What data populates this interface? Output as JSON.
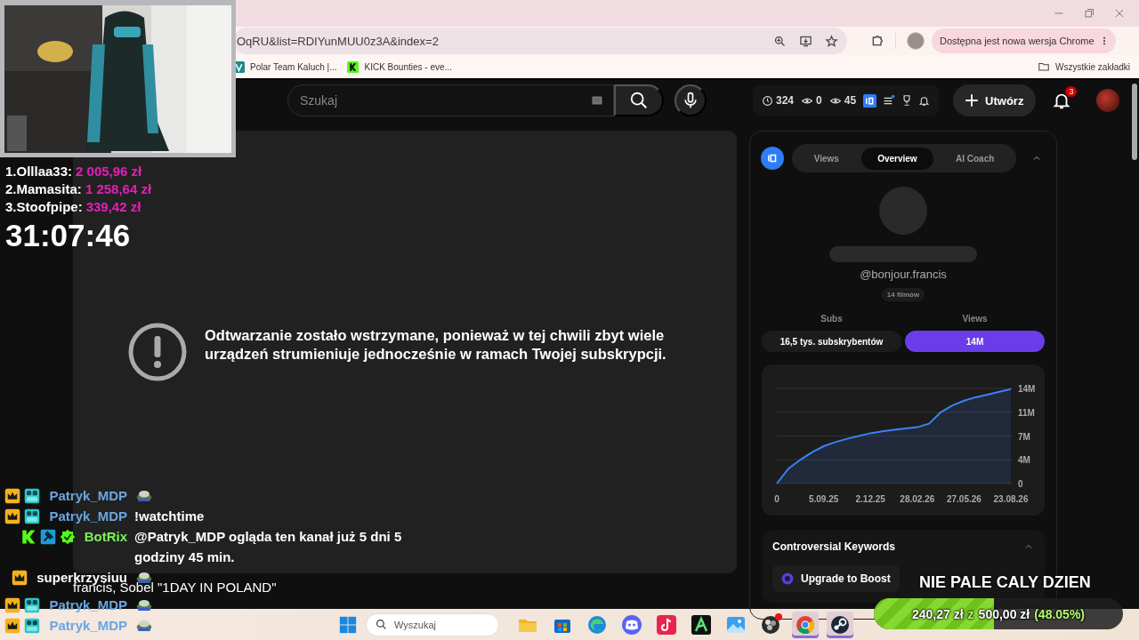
{
  "browser": {
    "address": {
      "url": "OqRU&list=RDIYunMUU0z3A&index=2"
    },
    "update_pill": "Dostępna jest nowa wersja Chrome",
    "bookmarks": [
      {
        "label": "Polar Team Kaluch |...",
        "kind": "polar"
      },
      {
        "label": "KICK Bounties - eve...",
        "kind": "kick"
      }
    ],
    "all_bookmarks": "Wszystkie zakładki"
  },
  "youtube": {
    "search": {
      "placeholder": "Szukaj"
    },
    "stats": [
      {
        "kind": "clock",
        "value": "324"
      },
      {
        "kind": "eye",
        "value": "0"
      },
      {
        "kind": "eye",
        "value": "45"
      }
    ],
    "create_button": "Utwórz",
    "notifications": "3",
    "player_message": "Odtwarzanie zostało wstrzymane, ponieważ w tej chwili zbyt wiele urządzeń strumieniuje jednocześnie w ramach Twojej subskrypcji.",
    "iq_panel": {
      "tabs": [
        {
          "label": "Views",
          "selected": false
        },
        {
          "label": "Overview",
          "selected": true
        },
        {
          "label": "AI Coach",
          "selected": false
        }
      ],
      "handle": "@bonjour.francis",
      "video_count": "14 filmów",
      "metrics": [
        {
          "label": "Subs",
          "value": "16,5 tys. subskrybentów",
          "selected": false
        },
        {
          "label": "Views",
          "value": "14M",
          "selected": true
        }
      ],
      "chart_data": {
        "type": "area",
        "categories": [
          "0",
          null,
          null,
          null,
          "5.09.25",
          null,
          null,
          null,
          "2.12.25",
          null,
          null,
          null,
          "28.02.26",
          null,
          null,
          null,
          "27.05.26",
          null,
          null,
          null,
          "23.08.26"
        ],
        "series": [
          {
            "color": "#3b82f6",
            "values": [
              0,
              2.2,
              3.5,
              4.6,
              5.5,
              6.1,
              6.6,
              7.0,
              7.4,
              7.7,
              7.9,
              8.1,
              8.3,
              8.8,
              10.5,
              11.5,
              12.2,
              12.7,
              13.1,
              13.5,
              13.9
            ]
          }
        ],
        "ylim": [
          0,
          14
        ],
        "grid": true,
        "yticks": [
          {
            "value": 0,
            "label": "0"
          },
          {
            "value": 3.5,
            "label": "4M"
          },
          {
            "value": 7,
            "label": "7M"
          },
          {
            "value": 10.5,
            "label": "11M"
          },
          {
            "value": 14,
            "label": "14M"
          }
        ]
      }
    },
    "keywords_card": {
      "title": "Controversial Keywords",
      "expanded": true,
      "upgrade": "Upgrade to Boost"
    }
  },
  "stream_overlay": {
    "leaderboard": [
      {
        "name": "1.Olllaa33:",
        "amount": "2 005,96 zł"
      },
      {
        "name": "2.Mamasita:",
        "amount": "1 258,64 zł"
      },
      {
        "name": "3.Stoofpipe:",
        "amount": "339,42 zł"
      }
    ],
    "timer": "31:07:46",
    "chat": [
      {
        "user": "Patryk_MDP",
        "color": "#6aa6e0",
        "badges": [
          {
            "kind": "crown"
          },
          {
            "kind": "og"
          }
        ],
        "kind": "emote"
      },
      {
        "user": "Patryk_MDP",
        "color": "#6aa6e0",
        "badges": [
          {
            "kind": "crown"
          },
          {
            "kind": "og"
          }
        ],
        "kind": "text",
        "text": "!watchtime"
      },
      {
        "user": "BotRix",
        "color": "#7cf25c",
        "badges": [
          {
            "kind": "kick"
          },
          {
            "kind": "hammer"
          },
          {
            "kind": "verified"
          }
        ],
        "kind": "text",
        "text": "@Patryk_MDP ogląda ten kanał już 5 dni 5 godziny 45 min."
      },
      {
        "user": "superkrzysiuu",
        "color": "#ffffff",
        "badges": [
          {
            "kind": "crown"
          }
        ],
        "kind": "emote"
      },
      {
        "kind": "caption",
        "text": "francis, Sobel \"1DAY IN POLAND\""
      },
      {
        "user": "Patryk_MDP",
        "color": "#6aa6e0",
        "badges": [
          {
            "kind": "crown"
          },
          {
            "kind": "og"
          }
        ],
        "kind": "emote"
      },
      {
        "user": "Patryk_MDP",
        "color": "#6aa6e0",
        "badges": [
          {
            "kind": "crown"
          },
          {
            "kind": "og"
          }
        ],
        "kind": "emote"
      }
    ],
    "goal": {
      "title": "NIE PALE CALY DZIEN",
      "raised": "240,27 zł",
      "separator": "z",
      "target": "500,00 zł",
      "percent": "(48.05%)",
      "level": 0.4805
    }
  },
  "taskbar": {
    "search": {
      "placeholder": "Wyszukaj"
    },
    "apps": [
      {
        "kind": "files",
        "selected": false,
        "alert": false
      },
      {
        "kind": "store",
        "selected": false,
        "alert": false
      },
      {
        "kind": "edge",
        "selected": false,
        "alert": false
      },
      {
        "kind": "discord",
        "selected": false,
        "alert": false
      },
      {
        "kind": "tiktok",
        "selected": false,
        "alert": false
      },
      {
        "kind": "editor",
        "selected": false,
        "alert": false
      },
      {
        "kind": "photos",
        "selected": false,
        "alert": false
      },
      {
        "kind": "obs",
        "selected": false,
        "alert": true
      },
      {
        "kind": "chrome",
        "selected": true,
        "alert": false
      },
      {
        "kind": "steam",
        "selected": true,
        "alert": false
      }
    ]
  }
}
